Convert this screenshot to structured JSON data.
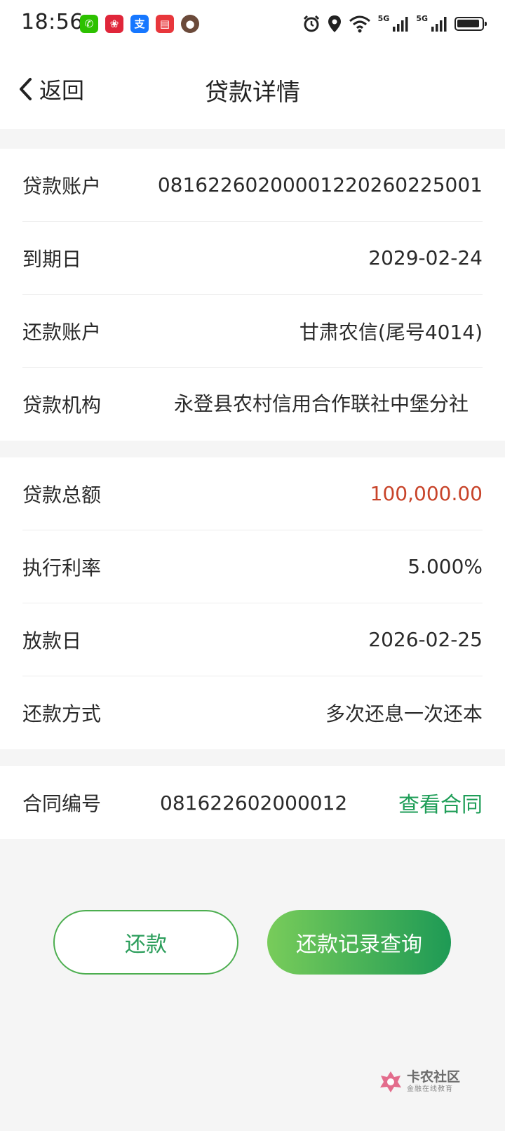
{
  "status_bar": {
    "time": "18:56",
    "app_icons": [
      {
        "name": "wechat-icon",
        "color": "#2dc100",
        "glyph": "✆"
      },
      {
        "name": "shopping-app-icon",
        "color": "#e0263a",
        "glyph": "❀"
      },
      {
        "name": "alipay-icon",
        "color": "#1677ff",
        "glyph": "支"
      },
      {
        "name": "reader-app-icon",
        "color": "#e8373c",
        "glyph": "▤"
      },
      {
        "name": "avatar-app-icon",
        "color": "#6b4a3a",
        "glyph": "●"
      }
    ],
    "network_labels": [
      "5G",
      "5G"
    ],
    "battery_level": 0.95
  },
  "nav": {
    "back_label": "返回",
    "title": "贷款详情"
  },
  "loan_info": {
    "rows": [
      {
        "label": "贷款账户",
        "value": "081622602000012202602250​01"
      },
      {
        "label": "到期日",
        "value": "2029-02-24"
      },
      {
        "label": "还款账户",
        "value": "甘肃农信(尾号4014)"
      },
      {
        "label": "贷款机构",
        "value": "永登县农村信用合作联社中堡分社"
      }
    ]
  },
  "loan_amounts": {
    "rows": [
      {
        "label": "贷款总额",
        "value": "100,000.00"
      },
      {
        "label": "执行利率",
        "value": "5.000%"
      },
      {
        "label": "放款日",
        "value": "2026-02-25"
      },
      {
        "label": "还款方式",
        "value": "多次还息一次还本"
      }
    ]
  },
  "contract": {
    "label": "合同编号",
    "number": "081622602000012",
    "view_label": "查看合同"
  },
  "actions": {
    "repay_label": "还款",
    "records_label": "还款记录查询"
  },
  "watermark": {
    "title": "卡农社区",
    "subtitle": "金融在线教育"
  },
  "colors": {
    "accent_green": "#1f9e58",
    "amount_red": "#c8442a",
    "page_bg": "#f5f5f5"
  }
}
